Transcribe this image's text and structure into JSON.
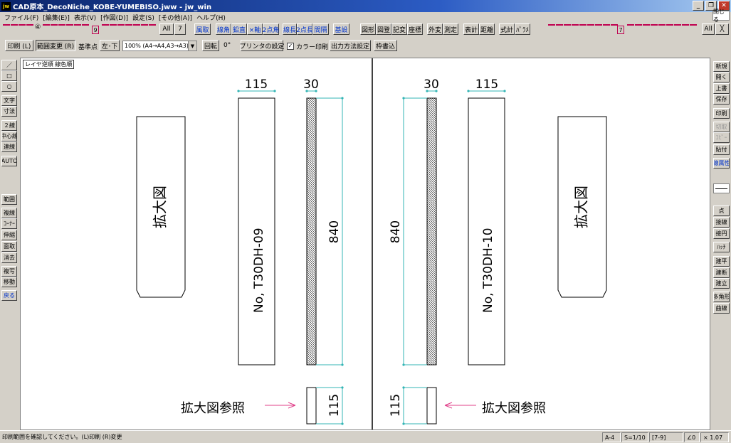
{
  "window": {
    "title": "CAD原本_DecoNiche_KOBE-YUMEBISO.jww - jw_win",
    "app_icon": "jw",
    "close_small": "閉じる"
  },
  "menu": [
    "ファイル(F)",
    "[編集(E)]",
    "表示(V)",
    "[作図(D)]",
    "設定(S)",
    "[その他(A)]",
    "ヘルプ(H)"
  ],
  "toolbar1": {
    "layer_group_num": "④",
    "layer_num": "9",
    "all": "All",
    "layer_num2": "7",
    "buttons": [
      "属取",
      "線角",
      "鉛直",
      "×軸",
      "2点角",
      "線長",
      "2点長",
      "間隔",
      "基設",
      "図形",
      "図登",
      "記変",
      "座標",
      "外変",
      "測定",
      "表計",
      "距離",
      "式計",
      "ﾊﾟﾗﾒ"
    ],
    "right_layer_num": "7",
    "right_all": "All",
    "right_x": "╳"
  },
  "toolbar2": {
    "print": "印刷 (L)",
    "range_change": "範囲変更 (R)",
    "base_point_label": "基準点",
    "base_point_value": "左･下",
    "scale_combo": "100% (A4→A4,A3→A3)",
    "rotate": "回転",
    "rotate_value": "0°",
    "printer_settings": "プリンタの設定",
    "color_print_checked": "✓",
    "color_print": "カラー印刷",
    "output_settings": "出力方法設定",
    "frame_write": "枠書込"
  },
  "left_tools": [
    "／",
    "□",
    "○",
    "文字",
    "寸法",
    "２線",
    "中心線",
    "連線",
    "AUTO",
    "範囲",
    "複線",
    "ｺｰﾅｰ",
    "伸縮",
    "面取",
    "消去",
    "複写",
    "移動",
    "戻る"
  ],
  "right_tools": [
    "新規",
    "開く",
    "上書",
    "保存",
    "印刷",
    "切取",
    "ｺﾋﾟｰ",
    "貼付",
    "線属性",
    "点",
    "接線",
    "接円",
    "ﾊｯﾁ",
    "建平",
    "建断",
    "建立",
    "多角形",
    "曲線"
  ],
  "canvas": {
    "layer_order": "レイヤ逆順  線色順",
    "left": {
      "zoom_label": "拡大図",
      "part_label": "No, T30DH-09",
      "dim_width": "115",
      "dim_thickness": "30",
      "dim_length": "840",
      "dim_bottom": "115",
      "ref_label": "拡大図参照"
    },
    "right": {
      "zoom_label": "拡大図",
      "part_label": "No, T30DH-10",
      "dim_width": "115",
      "dim_thickness": "30",
      "dim_length": "840",
      "dim_bottom": "115",
      "ref_label": "拡大図参照"
    }
  },
  "statusbar": {
    "message": "印刷範囲を確認してください。(L)印刷 (R)変更",
    "paper": "A-4",
    "scale": "S=1/10",
    "layer": "[7-9]",
    "angle": "∠0",
    "zoom": "× 1.07"
  },
  "colors": {
    "cyan": "#33b5b5",
    "pink": "#e0408a",
    "layer": "#c00050"
  }
}
